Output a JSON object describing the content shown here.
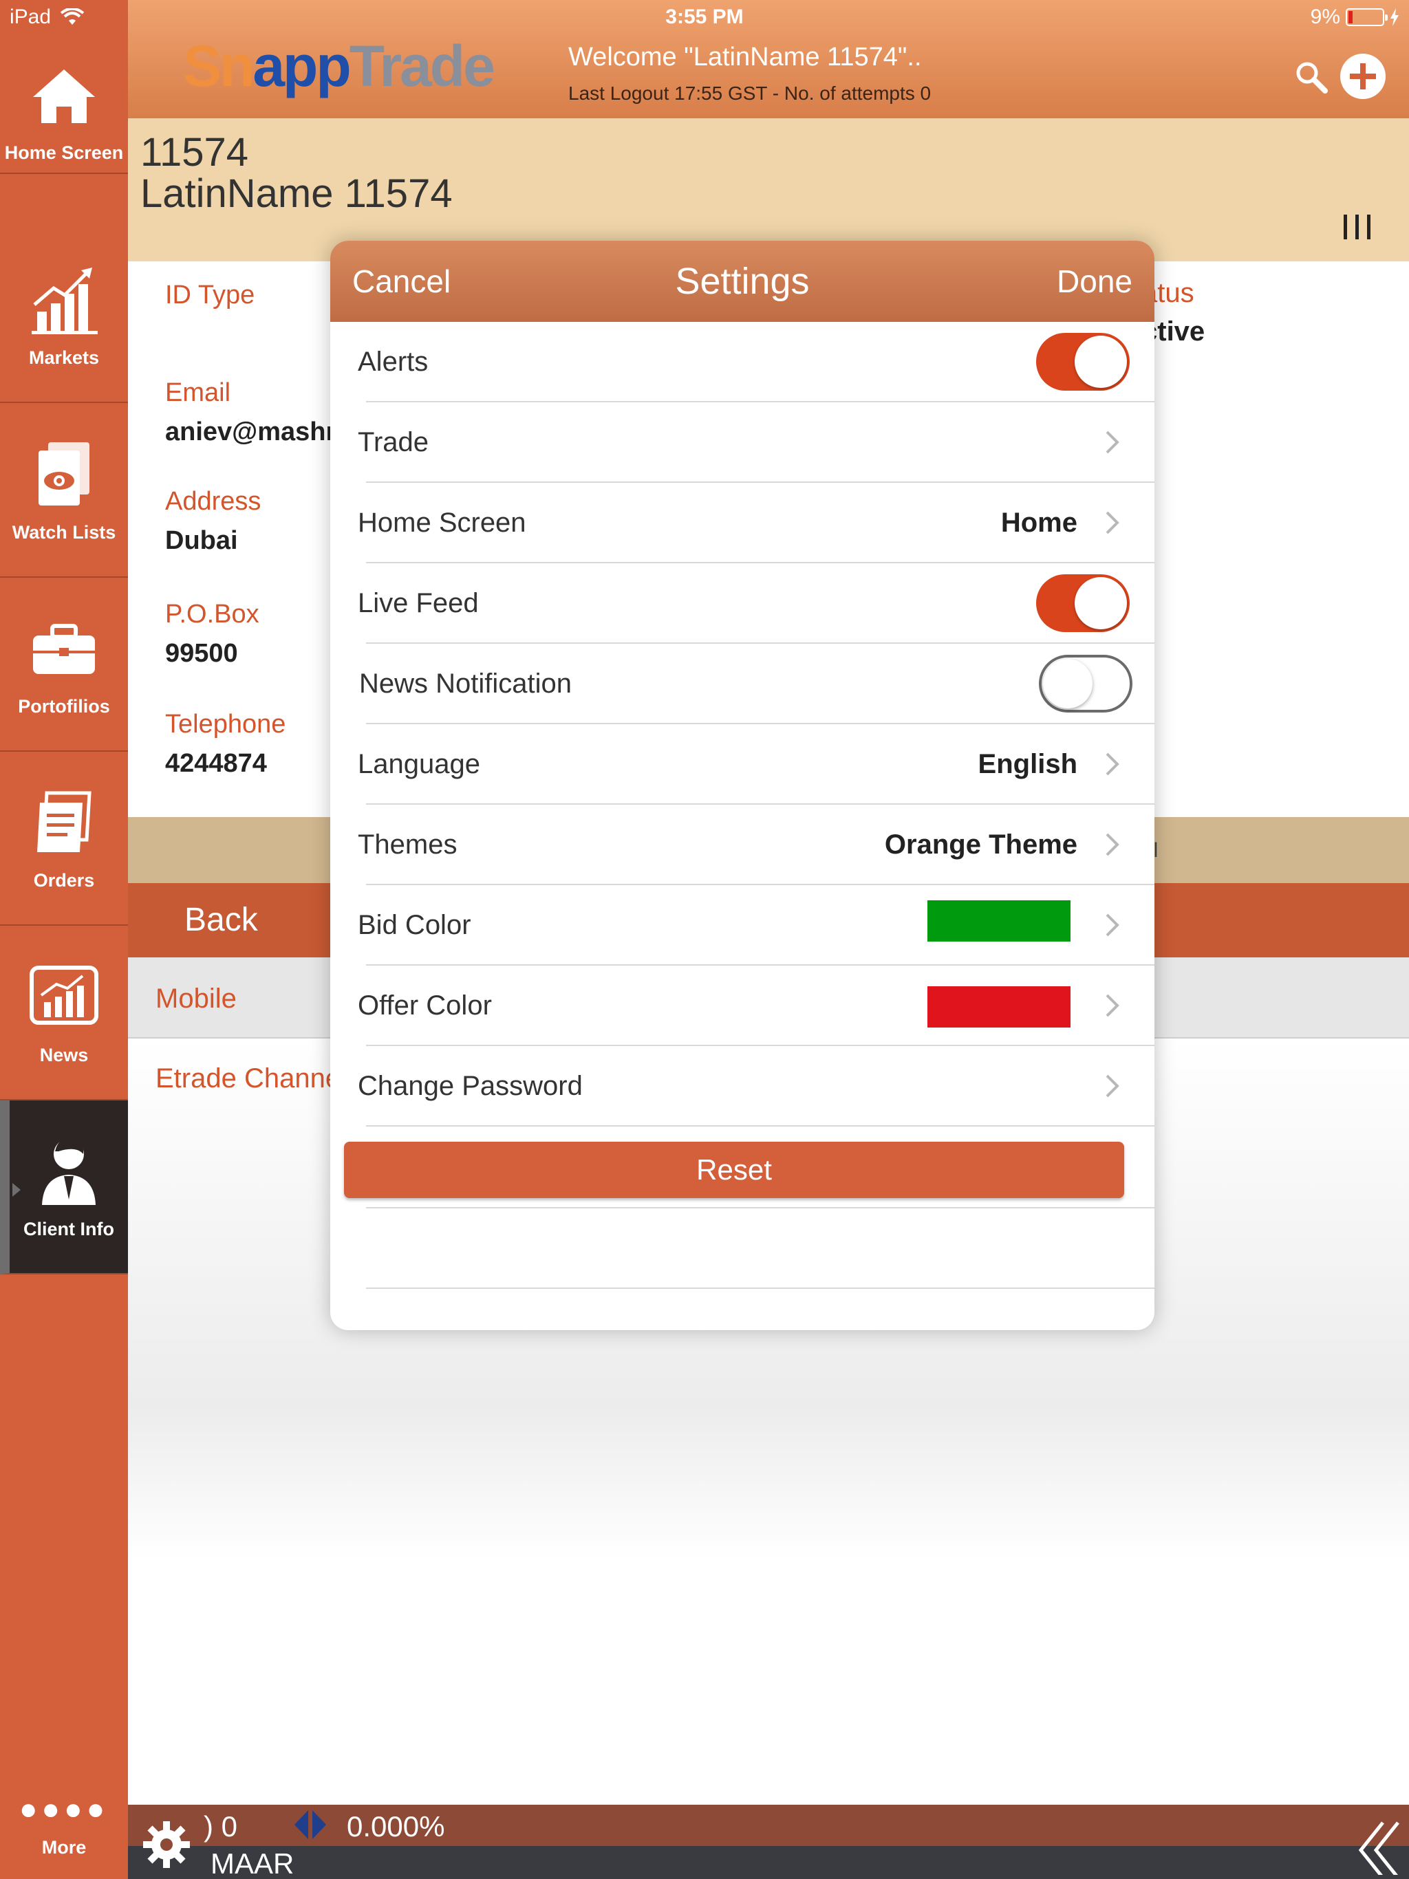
{
  "status_bar": {
    "carrier": "iPad",
    "time": "3:55 PM",
    "battery": "9%"
  },
  "sidebar": {
    "items": [
      {
        "label": "Home Screen",
        "icon": "home-icon"
      },
      {
        "label": "Markets",
        "icon": "chart-icon"
      },
      {
        "label": "Watch Lists",
        "icon": "eye-document-icon"
      },
      {
        "label": "Portofilios",
        "icon": "briefcase-icon"
      },
      {
        "label": "Orders",
        "icon": "orders-icon"
      },
      {
        "label": "News",
        "icon": "news-chart-icon"
      },
      {
        "label": "Client Info",
        "icon": "user-icon"
      }
    ],
    "more_label": "More"
  },
  "header": {
    "logo_part1": "Sn",
    "logo_part2": "app",
    "logo_part3": "Trade",
    "welcome": "Welcome \"LatinName 11574\"..",
    "last_logout": "Last Logout 17:55 GST - No. of attempts 0"
  },
  "client": {
    "id": "11574",
    "name": "LatinName 11574"
  },
  "details": {
    "id_type_label": "ID Type",
    "email_label": "Email",
    "email_value": "aniev@mashr",
    "address_label": "Address",
    "address_value": "Dubai",
    "pobox_label": "P.O.Box",
    "pobox_value": "99500",
    "telephone_label": "Telephone",
    "telephone_value": "4244874",
    "status_label": "atus",
    "status_value": "ctive",
    "tanbar_text": "el",
    "back_label": "Back",
    "mobile_label": "Mobile",
    "etrade_label": "Etrade Channe"
  },
  "ticker": {
    "left_value": ") 0",
    "change": "0.000%",
    "symbol": "MAAR"
  },
  "settings": {
    "title": "Settings",
    "cancel_label": "Cancel",
    "done_label": "Done",
    "rows": [
      {
        "label": "Alerts",
        "toggle": true
      },
      {
        "label": "Trade"
      },
      {
        "label": "Home Screen",
        "value": "Home"
      },
      {
        "label": "Live Feed",
        "toggle": true
      },
      {
        "label": "News Notification",
        "toggle": false
      },
      {
        "label": "Language",
        "value": "English"
      },
      {
        "label": "Themes",
        "value": "Orange Theme"
      },
      {
        "label": "Bid Color",
        "swatch": "#009a0e"
      },
      {
        "label": "Offer Color",
        "swatch": "#e0141c"
      },
      {
        "label": "Change Password"
      }
    ],
    "reset_label": "Reset"
  },
  "colors": {
    "accent": "#d4603b",
    "sidebar_active": "#2d2524",
    "bid": "#009a0e",
    "offer": "#e0141c"
  }
}
